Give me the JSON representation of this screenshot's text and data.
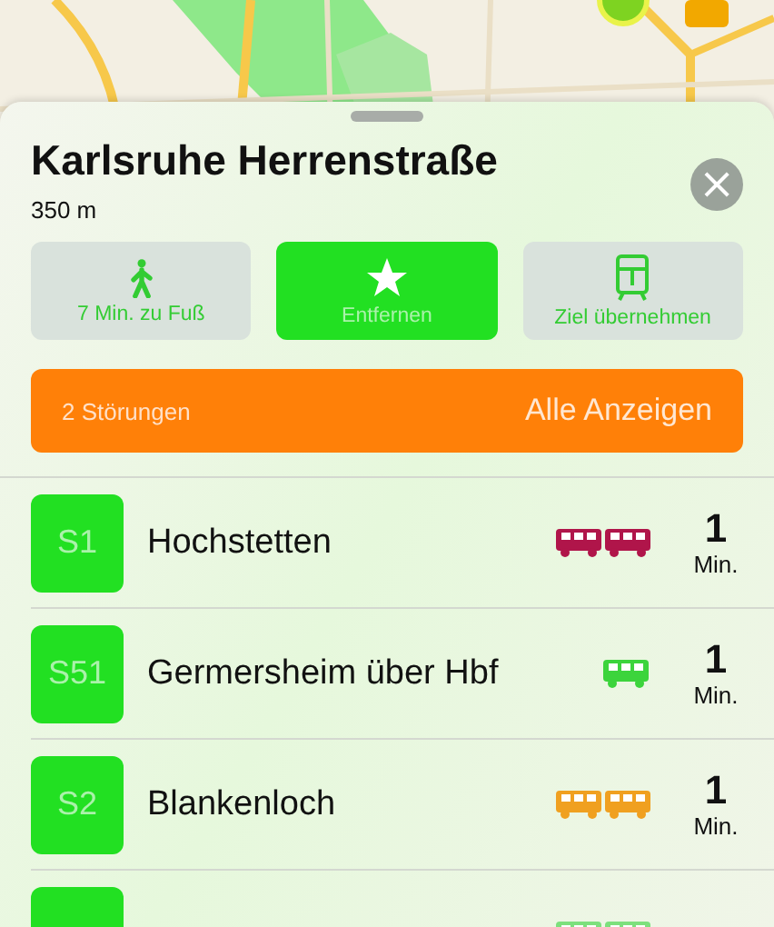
{
  "stop": {
    "title": "Karlsruhe Herrenstraße",
    "distance": "350 m"
  },
  "close_button": {
    "symbol": "×"
  },
  "actions": [
    {
      "kind": "walk",
      "label": "7 Min. zu Fuß",
      "selected": false
    },
    {
      "kind": "star",
      "label": "Entfernen",
      "selected": true
    },
    {
      "kind": "train",
      "label": "Ziel übernehmen",
      "selected": false
    }
  ],
  "disruptions": {
    "count_label": "2 Störungen",
    "link": "Alle Anzeigen"
  },
  "departures": [
    {
      "line": "S1",
      "destination": "Hochstetten",
      "kind": "double",
      "color": "#b0154a",
      "minutes": "1",
      "unit": "Min."
    },
    {
      "line": "S51",
      "destination": "Germersheim über Hbf",
      "kind": "single",
      "color": "#3cd43c",
      "minutes": "1",
      "unit": "Min."
    },
    {
      "line": "S2",
      "destination": "Blankenloch",
      "kind": "double",
      "color": "#f0a020",
      "minutes": "1",
      "unit": "Min."
    },
    {
      "kind": "double",
      "color": "#7de07d"
    }
  ]
}
